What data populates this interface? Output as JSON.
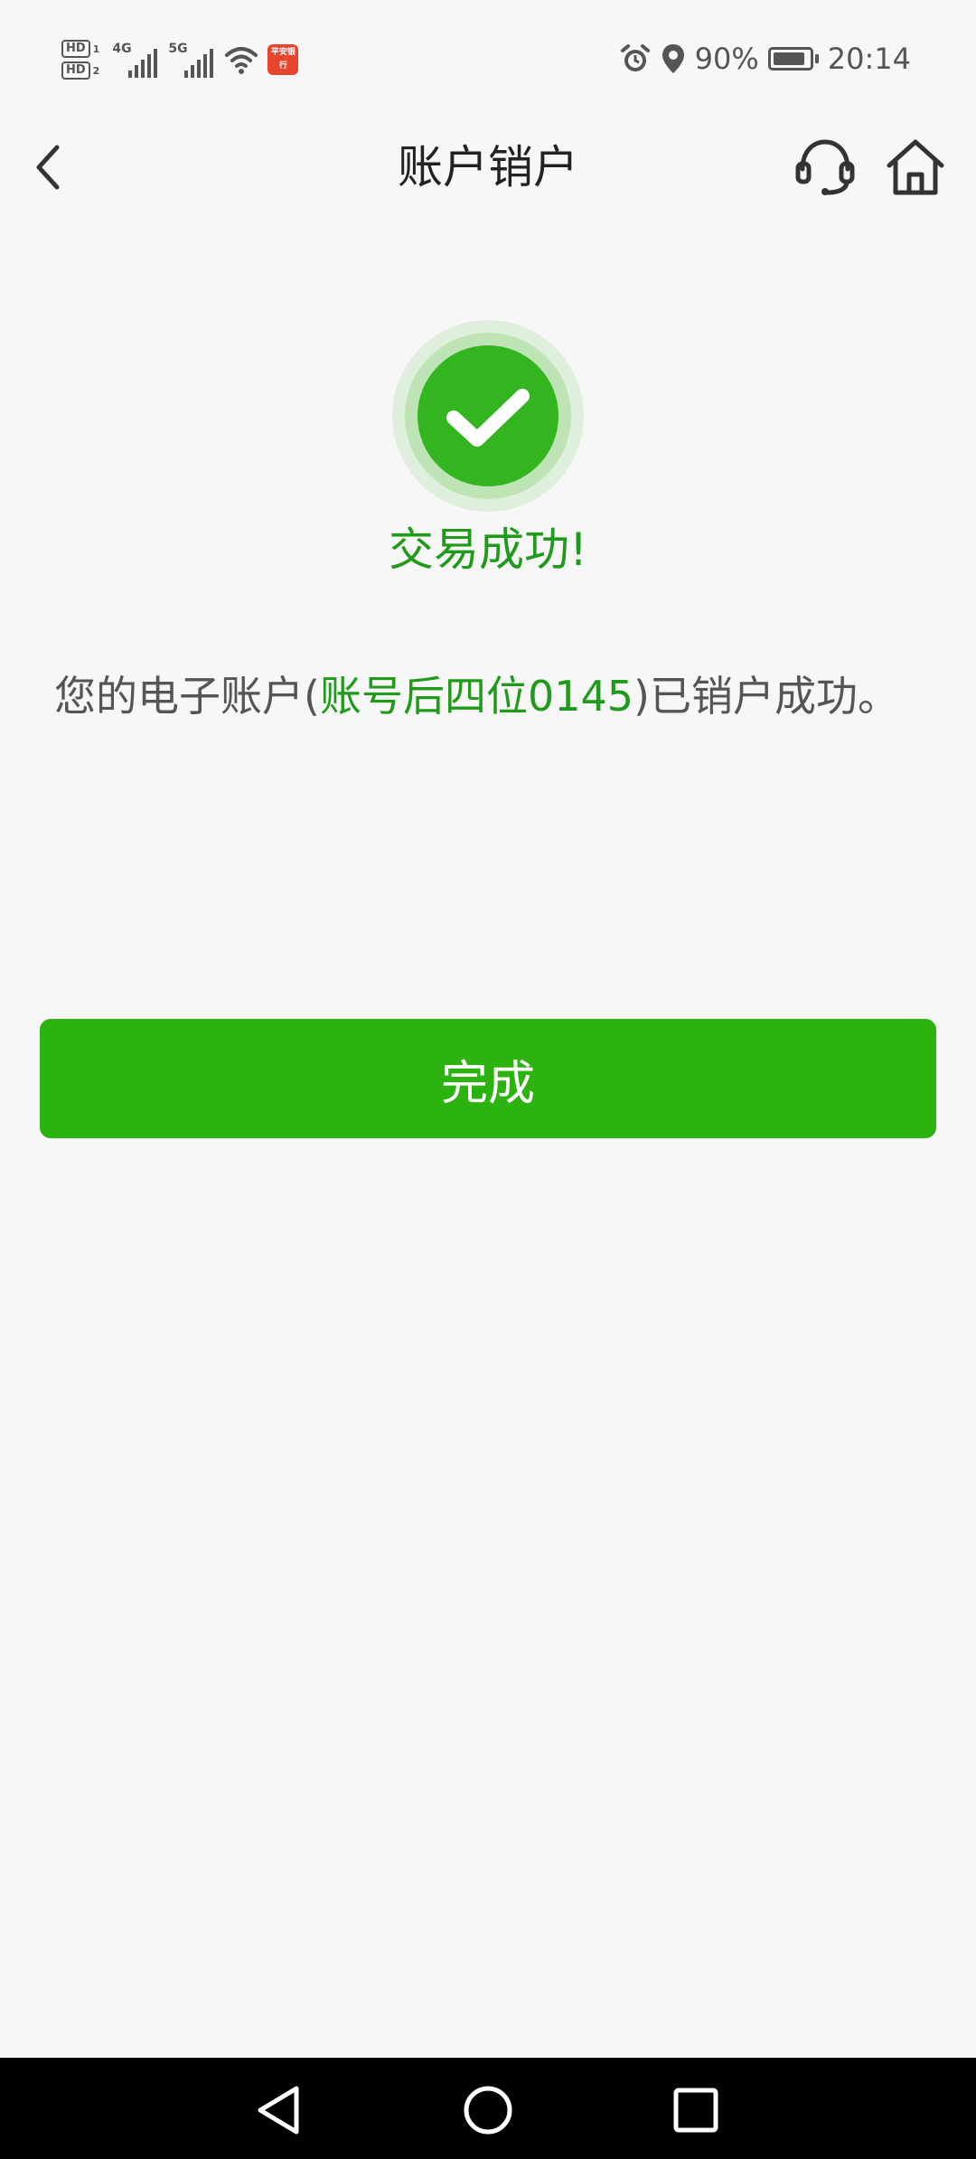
{
  "status_bar": {
    "hd1": "HD",
    "hd1_num": "1",
    "hd2": "HD",
    "hd2_num": "2",
    "signal1_gen": "4G",
    "signal2_gen": "5G",
    "app_badge_text": "平安银行",
    "battery": "90%",
    "time": "20:14",
    "battery_level": 0.9
  },
  "header": {
    "title": "账户销户",
    "back_icon": "chevron-left-icon",
    "service_icon": "headset-icon",
    "home_icon": "home-icon"
  },
  "result": {
    "title": "交易成功!",
    "message_prefix": "您的电子账户(",
    "message_highlight": "账号后四位0145",
    "message_suffix": ")已销户成功。"
  },
  "actions": {
    "done_label": "完成"
  },
  "colors": {
    "accent_green": "#2cb30f",
    "text_green": "#1f9a1a"
  }
}
